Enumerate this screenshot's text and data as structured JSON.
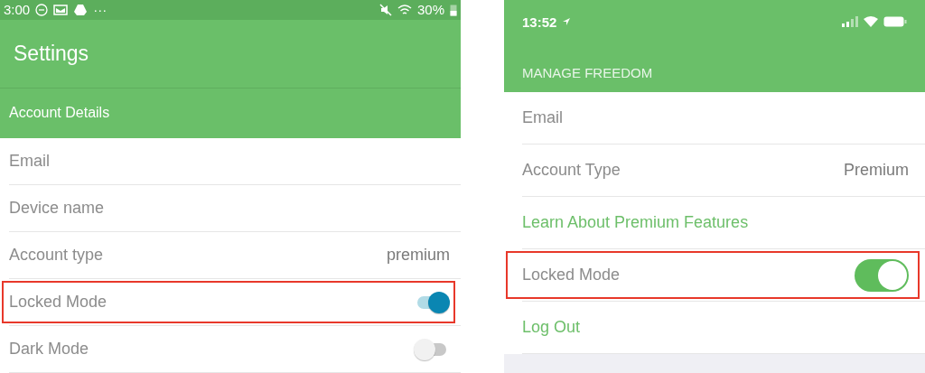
{
  "panels": [
    {
      "kind": "android",
      "status_bar": {
        "time": "3:00",
        "more": "···",
        "battery": "30%"
      },
      "title": "Settings",
      "section": "Account Details",
      "rows": [
        {
          "kind": "text",
          "label": "Email",
          "highlighted": false
        },
        {
          "kind": "text",
          "label": "Device name",
          "highlighted": false
        },
        {
          "kind": "value",
          "label": "Account type",
          "value": "premium",
          "highlighted": false
        },
        {
          "kind": "toggle",
          "label": "Locked Mode",
          "on": true,
          "highlighted": true
        },
        {
          "kind": "toggle",
          "label": "Dark Mode",
          "on": false,
          "highlighted": false
        }
      ]
    },
    {
      "kind": "ios",
      "status_bar": {
        "time": "13:52"
      },
      "section": "MANAGE FREEDOM",
      "rows": [
        {
          "kind": "text",
          "label": "Email",
          "highlighted": false
        },
        {
          "kind": "value",
          "label": "Account Type",
          "value": "Premium",
          "highlighted": false
        },
        {
          "kind": "link",
          "label": "Learn About Premium Features",
          "highlighted": false
        },
        {
          "kind": "toggle",
          "label": "Locked Mode",
          "on": true,
          "highlighted": true
        },
        {
          "kind": "link",
          "label": "Log Out",
          "highlighted": false
        }
      ]
    }
  ]
}
